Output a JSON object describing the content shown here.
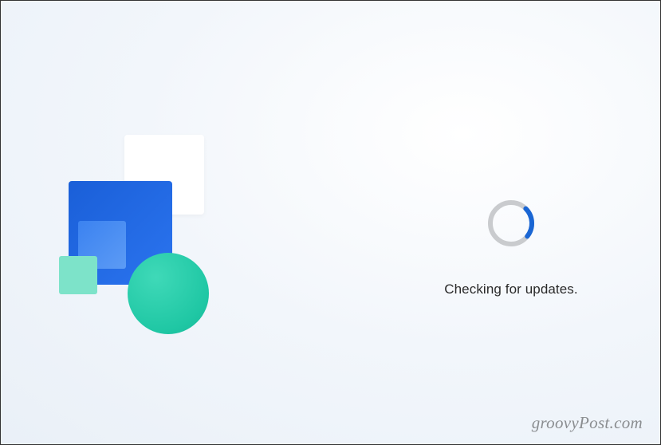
{
  "status": {
    "message": "Checking for updates."
  },
  "watermark": "groovyPost.com",
  "colors": {
    "spinner_track": "#c9cbce",
    "spinner_arc": "#1a66d4",
    "blue_square": "#2b74ef",
    "teal_circle": "#1fc7a4",
    "teal_square": "#7de3c9"
  }
}
